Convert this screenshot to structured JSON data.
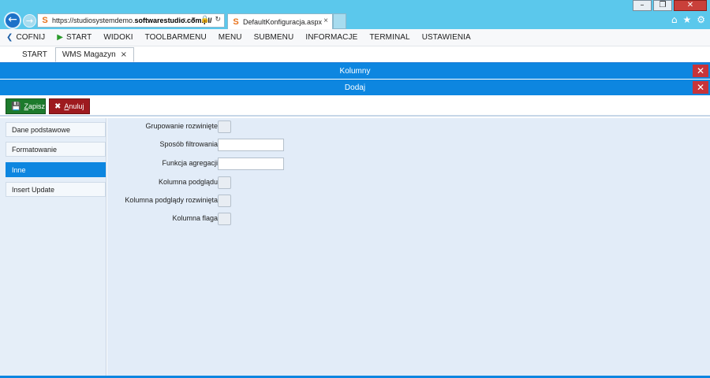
{
  "browser": {
    "window_buttons": {
      "minimize": "–",
      "restore": "❐",
      "close": "✕"
    },
    "url_prefix": "https://studiosystemdemo.",
    "url_domain": "softwarestudio.com.pl/",
    "address_icons": "⌕ ▾ 🔒 ↻",
    "tab_title": "DefaultKonfiguracja.aspx",
    "tab_close": "×",
    "right_icons": [
      "⌂",
      "★",
      "⚙"
    ]
  },
  "menu": {
    "items": [
      {
        "label": "COFNIJ",
        "icon": "back-icon"
      },
      {
        "label": "START",
        "icon": "play-icon"
      },
      {
        "label": "WIDOKI"
      },
      {
        "label": "TOOLBARMENU"
      },
      {
        "label": "MENU"
      },
      {
        "label": "SUBMENU"
      },
      {
        "label": "INFORMACJE"
      },
      {
        "label": "TERMINAL"
      },
      {
        "label": "USTAWIENIA"
      }
    ]
  },
  "page_tabs": [
    {
      "label": "START"
    },
    {
      "label": "WMS Magazyn",
      "close": "×"
    }
  ],
  "headers": {
    "first": "Kolumny",
    "second": "Dodaj",
    "close_glyph": "✕"
  },
  "actions": {
    "save_first": "Z",
    "save_rest": "apisz",
    "cancel_first": "A",
    "cancel_rest": "nuluj"
  },
  "sidebar": {
    "items": [
      {
        "label": "Dane podstawowe"
      },
      {
        "label": "Formatowanie"
      },
      {
        "label": "Inne",
        "active": true
      },
      {
        "label": "Insert Update"
      }
    ]
  },
  "form": {
    "fields": [
      {
        "label": "Grupowanie rozwinięte",
        "type": "checkbox",
        "checked": false
      },
      {
        "label": "Sposób filtrowania",
        "type": "text",
        "value": ""
      },
      {
        "label": "Funkcja agregacji",
        "type": "text",
        "value": ""
      },
      {
        "label": "Kolumna podglądu",
        "type": "checkbox",
        "checked": false
      },
      {
        "label": "Kolumna podglądy rozwinięta",
        "type": "checkbox",
        "checked": false
      },
      {
        "label": "Kolumna flaga",
        "type": "checkbox",
        "checked": false
      }
    ]
  },
  "colors": {
    "accent": "#0d86e0",
    "save": "#1d7a2c",
    "cancel": "#9e1a1f",
    "close": "#c7343a",
    "chrome": "#5bc8ec"
  }
}
